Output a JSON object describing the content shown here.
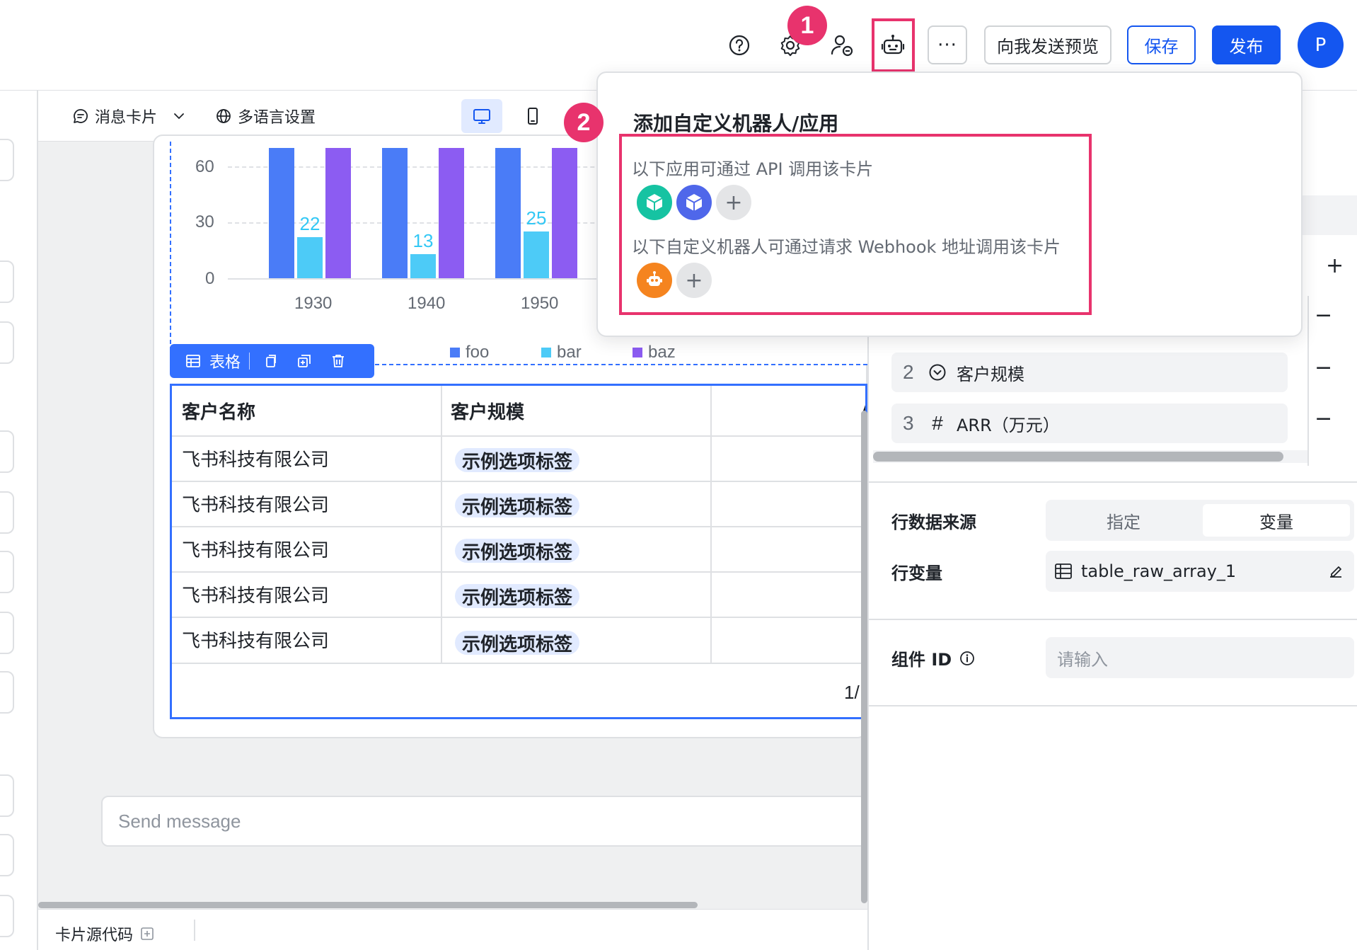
{
  "header": {
    "more_label": "···",
    "preview_label": "向我发送预览",
    "save_label": "保存",
    "publish_label": "发布",
    "avatar_letter": "P",
    "step1": "1",
    "step2": "2"
  },
  "subtoolbar": {
    "card_type": "消息卡片",
    "i18n_label": "多语言设置"
  },
  "chart_data": {
    "type": "bar",
    "categories": [
      "1930",
      "1940",
      "1950"
    ],
    "series": [
      {
        "name": "foo",
        "values": [
          70,
          70,
          70
        ]
      },
      {
        "name": "bar",
        "values": [
          22,
          13,
          25
        ]
      },
      {
        "name": "baz",
        "values": [
          70,
          70,
          70
        ]
      }
    ],
    "yticks": [
      "60",
      "30",
      "0"
    ],
    "data_labels": [
      "22",
      "13",
      "25"
    ],
    "ylim": [
      0,
      70
    ],
    "colors": {
      "foo": "#4a7cf7",
      "bar": "#4dcbf7",
      "baz": "#8c5cf2"
    }
  },
  "table_toolbar": {
    "label": "表格"
  },
  "table": {
    "headers": [
      "客户名称",
      "客户规模",
      "A"
    ],
    "rows": [
      {
        "name": "飞书科技有限公司",
        "tag": "示例选项标签"
      },
      {
        "name": "飞书科技有限公司",
        "tag": "示例选项标签"
      },
      {
        "name": "飞书科技有限公司",
        "tag": "示例选项标签"
      },
      {
        "name": "飞书科技有限公司",
        "tag": "示例选项标签"
      },
      {
        "name": "飞书科技有限公司",
        "tag": "示例选项标签"
      }
    ],
    "pagination": "1/"
  },
  "composer": {
    "placeholder": "Send message"
  },
  "bottom": {
    "source_code_label": "卡片源代码"
  },
  "right_panel": {
    "columns": [
      {
        "index": "2",
        "label": "客户规模"
      },
      {
        "index": "3",
        "label": "ARR（万元）"
      }
    ],
    "row_source_label": "行数据来源",
    "row_source_options": [
      "指定",
      "变量"
    ],
    "row_source_selected": "变量",
    "row_var_label": "行变量",
    "row_var_value": "table_raw_array_1",
    "component_id_label": "组件 ID",
    "component_id_placeholder": "请输入"
  },
  "popover": {
    "title": "添加自定义机器人/应用",
    "apps_caption": "以下应用可通过 API 调用该卡片",
    "bots_caption": "以下自定义机器人可通过请求 Webhook 地址调用该卡片"
  }
}
